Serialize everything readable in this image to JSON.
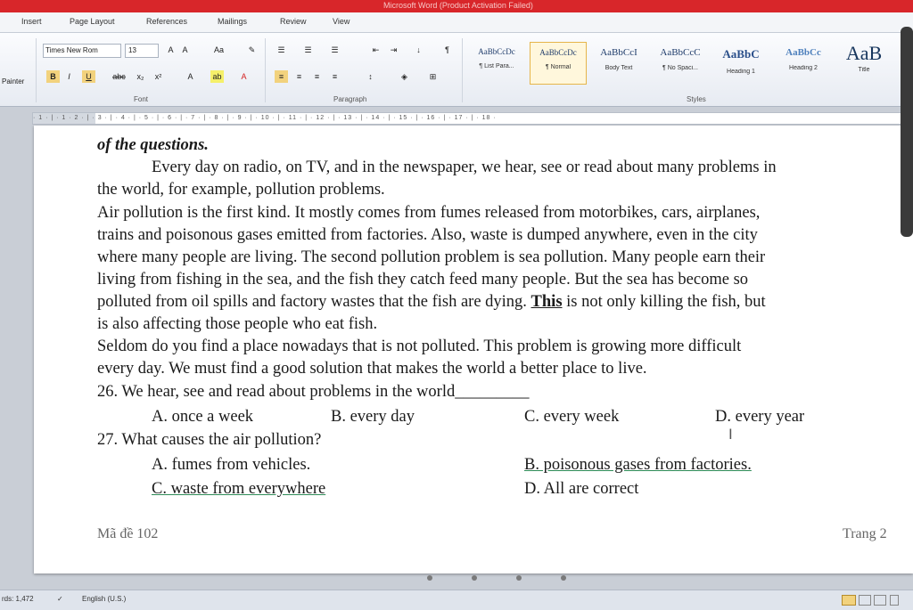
{
  "title": "Microsoft Word (Product Activation Failed)",
  "tabs": [
    "Insert",
    "Page Layout",
    "References",
    "Mailings",
    "Review",
    "View"
  ],
  "ribbon": {
    "painter_label": "Painter",
    "font_name": "Times New Rom",
    "font_size": "13",
    "groups": {
      "font": "Font",
      "paragraph": "Paragraph",
      "styles": "Styles"
    },
    "styles": [
      {
        "preview": "AaBbCcDc",
        "name": "¶ List Para..."
      },
      {
        "preview": "AaBbCcDc",
        "name": "¶ Normal"
      },
      {
        "preview": "AaBbCcI",
        "name": "Body Text"
      },
      {
        "preview": "AaBbCcC",
        "name": "¶ No Spaci..."
      },
      {
        "preview": "AaBbC",
        "name": "Heading 1"
      },
      {
        "preview": "AaBbCc",
        "name": "Heading 2"
      },
      {
        "preview": "AaB",
        "name": "Title"
      }
    ],
    "accent_color": "#e6b54a"
  },
  "ruler_text": "· 1 · | · 1 · 2 · | · 3 · | · 4 · | · 5 · | · 6 · | · 7 · | · 8 · | · 9 · | · 10 · | · 11 · | · 12 · | · 13 · | · 14 · | · 15 · | · 16 · | · 17 · | · 18 ·",
  "document": {
    "heading_tail": "of the questions.",
    "paragraph1": {
      "l1": "Every day on radio, on TV, and in the newspaper, we hear, see or read about many problems in",
      "l2": "the world, for example, pollution problems."
    },
    "paragraph2": {
      "l1": "Air pollution is the first kind. It mostly comes from fumes released from motorbikes, cars, airplanes,",
      "l2": "trains and poisonous gases emitted from factories. Also, waste is dumped anywhere, even in the city",
      "l3": "where many people are living. The second pollution problem is sea pollution. Many people earn their",
      "l4": "living from fishing in the sea, and the fish they catch feed many people. But the sea has become so",
      "l5_before": "polluted from oil spills and factory wastes that the fish are dying. ",
      "l5_this": "This",
      "l5_after": " is not only killing the fish, but",
      "l6": "is also affecting those people who eat fish."
    },
    "paragraph3": {
      "l1": "Seldom do you find a place nowadays that is not polluted. This problem is growing more difficult",
      "l2": "every day. We must find a good solution that makes the world a better place to live."
    },
    "q26": {
      "question": "26. We hear, see and read about problems in the world",
      "blank": "_________",
      "a": "A. once a week",
      "b": "B. every day",
      "c": "C. every week",
      "d": "D. every year"
    },
    "q27": {
      "question": "27. What causes the air pollution?",
      "a": "A. fumes from vehicles.",
      "b": "B. poisonous gases from factories.",
      "c": "C. waste from everywhere",
      "d": "D. All are correct"
    },
    "footer_left": "Mã đề 102",
    "footer_right": "Trang 2"
  },
  "status": {
    "words": "rds: 1,472",
    "language": "English (U.S.)"
  }
}
